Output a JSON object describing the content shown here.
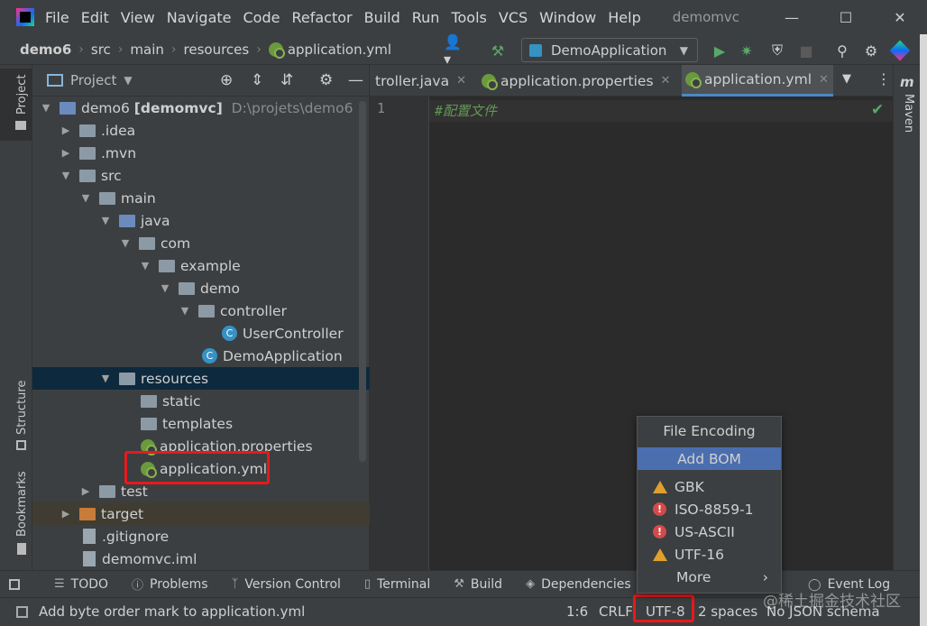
{
  "menubar": {
    "items": [
      "File",
      "Edit",
      "View",
      "Navigate",
      "Code",
      "Refactor",
      "Build",
      "Run",
      "Tools",
      "VCS",
      "Window",
      "Help"
    ],
    "project_title": "demomvc"
  },
  "navbar": {
    "crumbs": [
      "demo6",
      "src",
      "main",
      "resources",
      "application.yml"
    ],
    "run_config": "DemoApplication"
  },
  "left_stripe": {
    "project": "Project",
    "structure": "Structure",
    "bookmarks": "Bookmarks"
  },
  "right_stripe": {
    "maven": "Maven",
    "maven_glyph": "m"
  },
  "project_panel": {
    "title": "Project",
    "root_name": "demo6",
    "root_module": "[demomvc]",
    "root_path": "D:\\projets\\demo6",
    "tree": {
      "idea": ".idea",
      "mvn": ".mvn",
      "src": "src",
      "main": "main",
      "java": "java",
      "com": "com",
      "example": "example",
      "demo": "demo",
      "controller": "controller",
      "user_controller": "UserController",
      "demo_application": "DemoApplication",
      "resources": "resources",
      "static": "static",
      "templates": "templates",
      "app_properties": "application.properties",
      "app_yml": "application.yml",
      "test": "test",
      "target": "target",
      "gitignore": ".gitignore",
      "iml": "demomvc.iml"
    }
  },
  "editor": {
    "tabs": [
      "troller.java",
      "application.properties",
      "application.yml"
    ],
    "line_number": "1",
    "line_text": "#配置文件"
  },
  "encoding_popup": {
    "title": "File Encoding",
    "add_bom": "Add BOM",
    "options": [
      "GBK",
      "ISO-8859-1",
      "US-ASCII",
      "UTF-16"
    ],
    "more": "More"
  },
  "tool_windows": [
    "TODO",
    "Problems",
    "Version Control",
    "Terminal",
    "Build",
    "Dependencies",
    "Event Log"
  ],
  "statusbar": {
    "message": "Add byte order mark to application.yml",
    "position": "1:6",
    "line_sep": "CRLF",
    "encoding": "UTF-8",
    "indent": "2 spaces",
    "schema": "No JSON schema"
  },
  "watermark": "@稀土掘金技术社区",
  "colors": {
    "accent_blue": "#4a88c7",
    "selection": "#0d293e",
    "highlight_box": "#e8191c",
    "comment_green": "#629755"
  }
}
